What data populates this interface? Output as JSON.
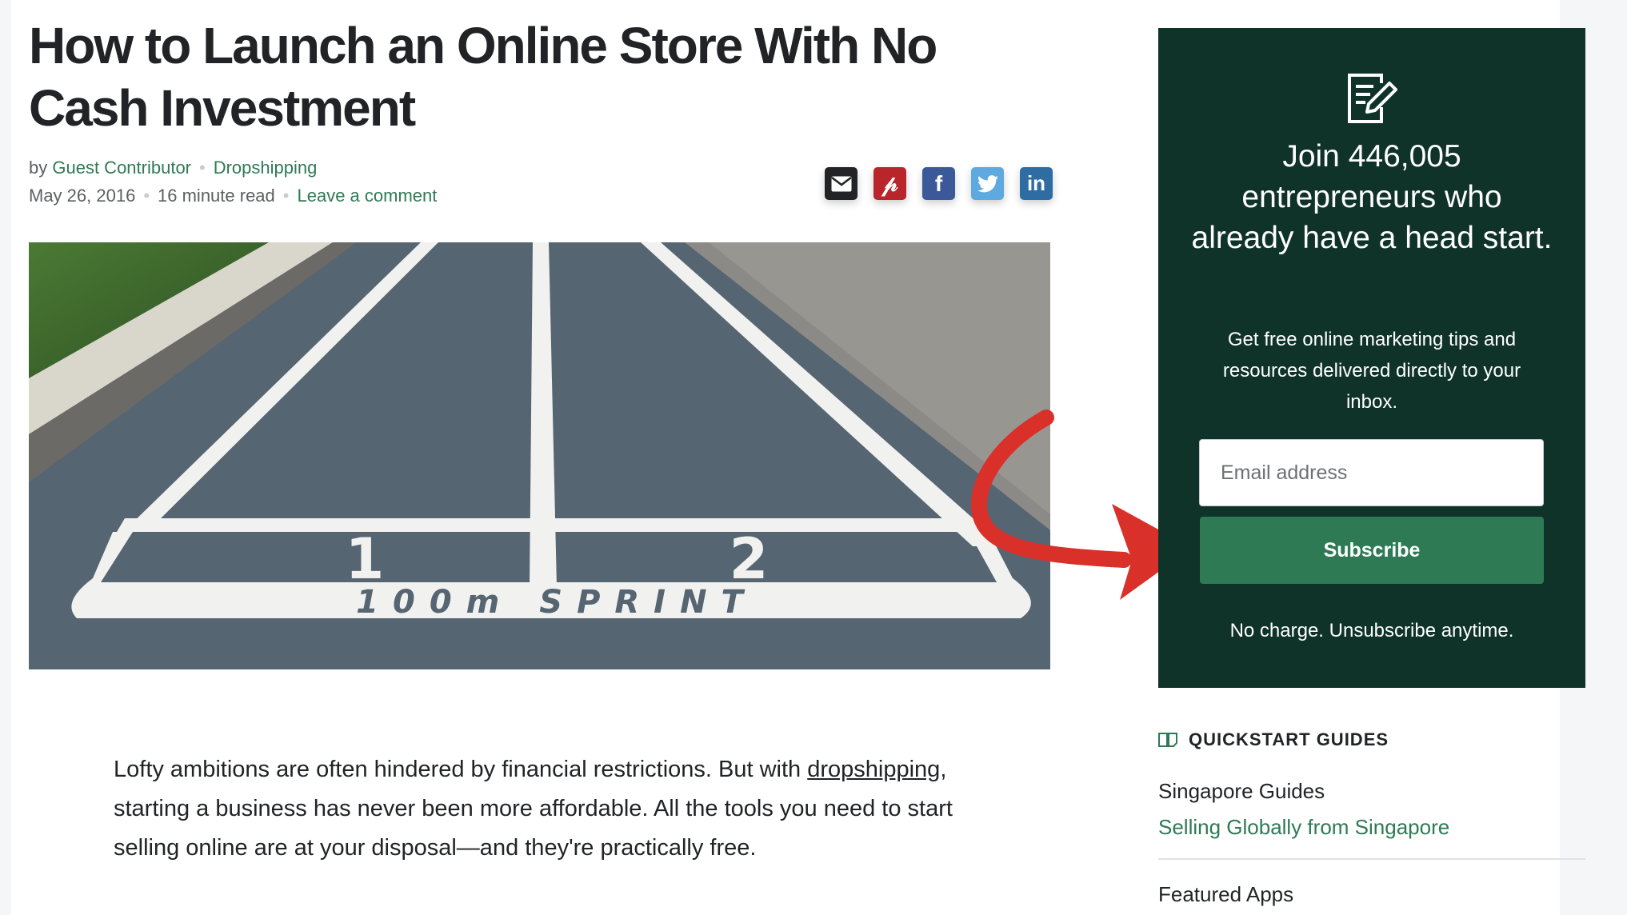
{
  "article": {
    "title": "How to Launch an Online Store With No Cash Investment",
    "by": "by",
    "author": "Guest Contributor",
    "category": "Dropshipping",
    "date": "May 26, 2016",
    "read_time": "16 minute read",
    "comment_link": "Leave a comment",
    "hero_text": {
      "lane1": "1",
      "lane2": "2",
      "sprint": "100m SPRINT"
    },
    "body_before_link": "Lofty ambitions are often hindered by financial restrictions. But with ",
    "body_link": "dropshipping",
    "body_after_link": ", starting a business has never been more affordable. All the tools you need to start selling online are at your disposal—and they're practically free."
  },
  "share": [
    {
      "icon": "email-icon",
      "glyph": "✉",
      "color": "#212326"
    },
    {
      "icon": "pinterest-icon",
      "glyph": "P",
      "color": "#b8262b"
    },
    {
      "icon": "facebook-icon",
      "glyph": "f",
      "color": "#3b5998"
    },
    {
      "icon": "twitter-icon",
      "glyph": "t",
      "color": "#5ea9dd"
    },
    {
      "icon": "linkedin-icon",
      "glyph": "in",
      "color": "#2e6da4"
    }
  ],
  "newsletter": {
    "heading": "Join 446,005 entrepreneurs who already have a head start.",
    "description": "Get free online marketing tips and resources delivered directly to your inbox.",
    "email_placeholder": "Email address",
    "subscribe_label": "Subscribe",
    "note": "No charge. Unsubscribe anytime.",
    "bg_color": "#0f3328",
    "button_color": "#2d7a55"
  },
  "sidebar": {
    "quickstart_heading": "QUICKSTART GUIDES",
    "guide_group": "Singapore Guides",
    "guide_link": "Selling Globally from Singapore",
    "featured_heading": "Featured Apps"
  }
}
